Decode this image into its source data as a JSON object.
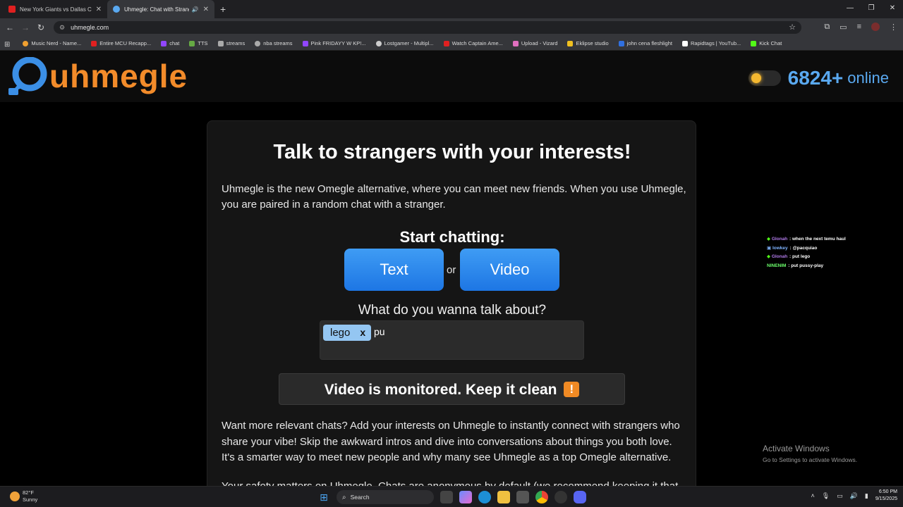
{
  "browser": {
    "tabs": [
      {
        "title": "New York Giants vs Dallas Cowb",
        "active": false,
        "icon": "youtube-icon"
      },
      {
        "title": "Uhmegle: Chat with Strange",
        "active": true,
        "icon": "uhmegle-icon"
      }
    ],
    "url": "uhmegle.com",
    "bookmarks": [
      {
        "label": "Music Nerd - Name...",
        "color": "#f0a030"
      },
      {
        "label": "Entire MCU Recapp...",
        "color": "#e02020"
      },
      {
        "label": "chat",
        "color": "#9146ff"
      },
      {
        "label": "TTS",
        "color": "#66aa44"
      },
      {
        "label": "streams",
        "color": "#aaaaaa"
      },
      {
        "label": "nba streams",
        "color": "#aaaaaa"
      },
      {
        "label": "Pink FRIDAYY W KP!...",
        "color": "#9146ff"
      },
      {
        "label": "Lostgamer - Multipl...",
        "color": "#cccccc"
      },
      {
        "label": "Watch Captain Ame...",
        "color": "#e02020"
      },
      {
        "label": "Upload - Vizard",
        "color": "#e070c0"
      },
      {
        "label": "Eklipse studio",
        "color": "#f0c020"
      },
      {
        "label": "john cena fleshlight",
        "color": "#3070e0"
      },
      {
        "label": "Rapidtags | YouTub...",
        "color": "#ffffff"
      },
      {
        "label": "Kick Chat",
        "color": "#53fc18"
      }
    ]
  },
  "site": {
    "logo_text": "uhmegle",
    "online_count": "6824+",
    "online_label": "online",
    "title": "Talk to strangers with your interests!",
    "intro": "Uhmegle is the new Omegle alternative, where you can meet new friends. When you use Uhmegle, you are paired in a random chat with a stranger.",
    "start_label": "Start chatting:",
    "text_button": "Text",
    "or_label": "or",
    "video_button": "Video",
    "interest_label": "What do you wanna talk about?",
    "interest_chip": "lego",
    "interest_chip_remove": "x",
    "interest_typed": "pu",
    "monitor_notice": "Video is monitored. Keep it clean",
    "warn_glyph": "!",
    "more_text": "Want more relevant chats? Add your interests on Uhmegle to instantly connect with strangers who share your vibe! Skip the awkward intros and dive into conversations about things you both love. It's a smarter way to meet new people and why many see Uhmegle as a top Omegle alternative.",
    "cut_text": "Your safety matters on Uhmegle. Chats are anonymous by default (we recommend keeping it that"
  },
  "overlay_chat": [
    {
      "icon": "◆",
      "user": "Glonah",
      "user_color": "#b07ae8",
      "message": "when the next temu haul"
    },
    {
      "icon": "▣",
      "user": "Iowkey",
      "user_color": "#7fb3ff",
      "message": "@pacquiao"
    },
    {
      "icon": "◆",
      "user": "Glonah",
      "user_color": "#b07ae8",
      "message": "put lego"
    },
    {
      "icon": "",
      "user": "NINENIM",
      "user_color": "#6cff6c",
      "message": "put pussy-play"
    }
  ],
  "activate_windows": {
    "title": "Activate Windows",
    "subtitle": "Go to Settings to activate Windows."
  },
  "taskbar": {
    "temp": "82°F",
    "condition": "Sunny",
    "search_label": "Search",
    "time": "6:50 PM",
    "date": "9/15/2025"
  }
}
